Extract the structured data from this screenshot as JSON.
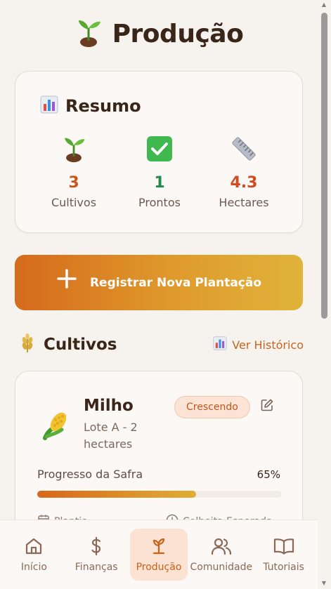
{
  "header": {
    "title": "Produção",
    "icon": "seedling-icon"
  },
  "summary": {
    "title": "Resumo",
    "stats": [
      {
        "value": "3",
        "label": "Cultivos",
        "color": "#c9571a",
        "icon": "seedling-icon"
      },
      {
        "value": "1",
        "label": "Prontos",
        "color": "#238a4a",
        "icon": "check-box-icon"
      },
      {
        "value": "4.3",
        "label": "Hectares",
        "color": "#d24a1e",
        "icon": "ruler-icon"
      }
    ]
  },
  "cta": {
    "label": "Registrar Nova Plantação"
  },
  "cultivos": {
    "title": "Cultivos",
    "history_link": "Ver Histórico",
    "items": [
      {
        "name": "Milho",
        "subtitle": "Lote A - 2 hectares",
        "status": "Crescendo",
        "progress_label": "Progresso da Safra",
        "progress_value": "65%",
        "progress": 0.65,
        "planted_label": "Plantio",
        "harvest_label": "Colheita Esperada"
      }
    ]
  },
  "nav": {
    "items": [
      {
        "label": "Início",
        "icon": "home-icon",
        "active": false
      },
      {
        "label": "Finanças",
        "icon": "dollar-icon",
        "active": false
      },
      {
        "label": "Produção",
        "icon": "sprout-icon",
        "active": true
      },
      {
        "label": "Comunidade",
        "icon": "users-icon",
        "active": false
      },
      {
        "label": "Tutoriais",
        "icon": "book-icon",
        "active": false
      }
    ]
  },
  "colors": {
    "accent": "#c9631b",
    "background": "#f6f2ee"
  }
}
